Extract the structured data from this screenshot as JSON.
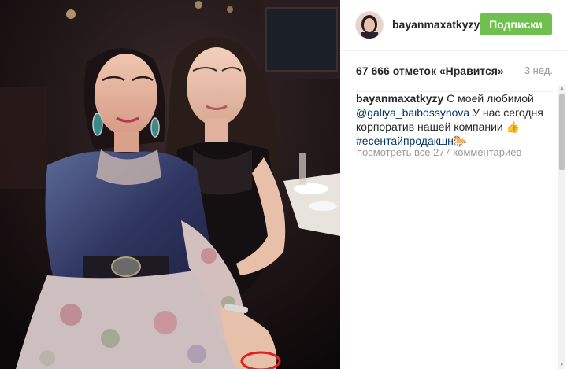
{
  "post": {
    "username": "bayanmaxatkyzy",
    "follow_label": "Подписки",
    "likes": "67 666 отметок «Нравится»",
    "age": "3 нед.",
    "caption": {
      "user": "bayanmaxatkyzy",
      "text_1": " С моей любимой ",
      "mention": "@galiya_baibossynova",
      "text_2": " У нас сегодня корпоратив нашей компании 👍",
      "hashtag": "#есентайпродакшн",
      "emoji": "🐎"
    },
    "comments_link": "посмотреть все 277 комментариев"
  },
  "icons": {
    "avatar": "profile-avatar",
    "scroll_up": "arrow-up-icon",
    "scroll_down": "arrow-down-icon"
  },
  "colors": {
    "follow_button": "#70c050",
    "link": "#003569",
    "muted": "#999999"
  }
}
